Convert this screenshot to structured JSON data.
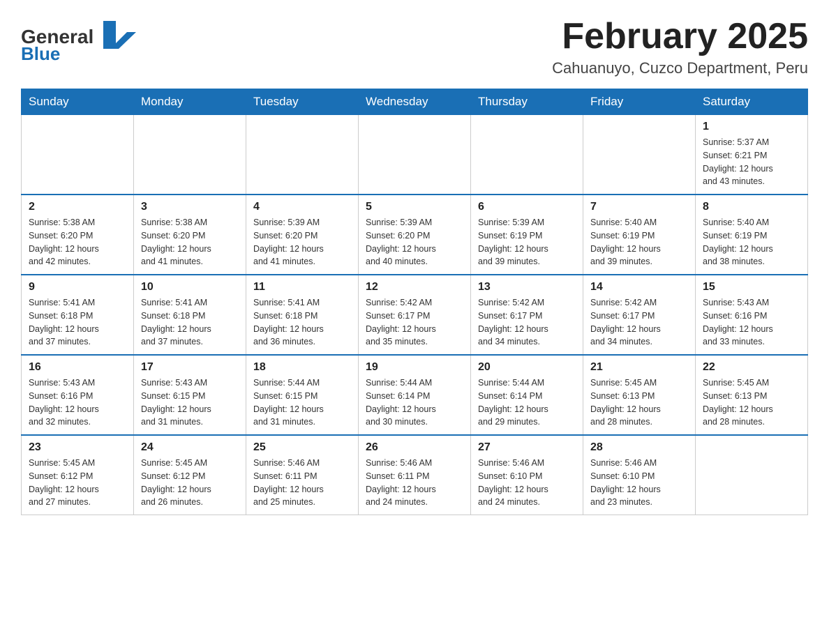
{
  "header": {
    "logo_general": "General",
    "logo_blue": "Blue",
    "month_title": "February 2025",
    "location": "Cahuanuyo, Cuzco Department, Peru"
  },
  "weekdays": [
    "Sunday",
    "Monday",
    "Tuesday",
    "Wednesday",
    "Thursday",
    "Friday",
    "Saturday"
  ],
  "weeks": [
    [
      {
        "day": "",
        "info": ""
      },
      {
        "day": "",
        "info": ""
      },
      {
        "day": "",
        "info": ""
      },
      {
        "day": "",
        "info": ""
      },
      {
        "day": "",
        "info": ""
      },
      {
        "day": "",
        "info": ""
      },
      {
        "day": "1",
        "info": "Sunrise: 5:37 AM\nSunset: 6:21 PM\nDaylight: 12 hours\nand 43 minutes."
      }
    ],
    [
      {
        "day": "2",
        "info": "Sunrise: 5:38 AM\nSunset: 6:20 PM\nDaylight: 12 hours\nand 42 minutes."
      },
      {
        "day": "3",
        "info": "Sunrise: 5:38 AM\nSunset: 6:20 PM\nDaylight: 12 hours\nand 41 minutes."
      },
      {
        "day": "4",
        "info": "Sunrise: 5:39 AM\nSunset: 6:20 PM\nDaylight: 12 hours\nand 41 minutes."
      },
      {
        "day": "5",
        "info": "Sunrise: 5:39 AM\nSunset: 6:20 PM\nDaylight: 12 hours\nand 40 minutes."
      },
      {
        "day": "6",
        "info": "Sunrise: 5:39 AM\nSunset: 6:19 PM\nDaylight: 12 hours\nand 39 minutes."
      },
      {
        "day": "7",
        "info": "Sunrise: 5:40 AM\nSunset: 6:19 PM\nDaylight: 12 hours\nand 39 minutes."
      },
      {
        "day": "8",
        "info": "Sunrise: 5:40 AM\nSunset: 6:19 PM\nDaylight: 12 hours\nand 38 minutes."
      }
    ],
    [
      {
        "day": "9",
        "info": "Sunrise: 5:41 AM\nSunset: 6:18 PM\nDaylight: 12 hours\nand 37 minutes."
      },
      {
        "day": "10",
        "info": "Sunrise: 5:41 AM\nSunset: 6:18 PM\nDaylight: 12 hours\nand 37 minutes."
      },
      {
        "day": "11",
        "info": "Sunrise: 5:41 AM\nSunset: 6:18 PM\nDaylight: 12 hours\nand 36 minutes."
      },
      {
        "day": "12",
        "info": "Sunrise: 5:42 AM\nSunset: 6:17 PM\nDaylight: 12 hours\nand 35 minutes."
      },
      {
        "day": "13",
        "info": "Sunrise: 5:42 AM\nSunset: 6:17 PM\nDaylight: 12 hours\nand 34 minutes."
      },
      {
        "day": "14",
        "info": "Sunrise: 5:42 AM\nSunset: 6:17 PM\nDaylight: 12 hours\nand 34 minutes."
      },
      {
        "day": "15",
        "info": "Sunrise: 5:43 AM\nSunset: 6:16 PM\nDaylight: 12 hours\nand 33 minutes."
      }
    ],
    [
      {
        "day": "16",
        "info": "Sunrise: 5:43 AM\nSunset: 6:16 PM\nDaylight: 12 hours\nand 32 minutes."
      },
      {
        "day": "17",
        "info": "Sunrise: 5:43 AM\nSunset: 6:15 PM\nDaylight: 12 hours\nand 31 minutes."
      },
      {
        "day": "18",
        "info": "Sunrise: 5:44 AM\nSunset: 6:15 PM\nDaylight: 12 hours\nand 31 minutes."
      },
      {
        "day": "19",
        "info": "Sunrise: 5:44 AM\nSunset: 6:14 PM\nDaylight: 12 hours\nand 30 minutes."
      },
      {
        "day": "20",
        "info": "Sunrise: 5:44 AM\nSunset: 6:14 PM\nDaylight: 12 hours\nand 29 minutes."
      },
      {
        "day": "21",
        "info": "Sunrise: 5:45 AM\nSunset: 6:13 PM\nDaylight: 12 hours\nand 28 minutes."
      },
      {
        "day": "22",
        "info": "Sunrise: 5:45 AM\nSunset: 6:13 PM\nDaylight: 12 hours\nand 28 minutes."
      }
    ],
    [
      {
        "day": "23",
        "info": "Sunrise: 5:45 AM\nSunset: 6:12 PM\nDaylight: 12 hours\nand 27 minutes."
      },
      {
        "day": "24",
        "info": "Sunrise: 5:45 AM\nSunset: 6:12 PM\nDaylight: 12 hours\nand 26 minutes."
      },
      {
        "day": "25",
        "info": "Sunrise: 5:46 AM\nSunset: 6:11 PM\nDaylight: 12 hours\nand 25 minutes."
      },
      {
        "day": "26",
        "info": "Sunrise: 5:46 AM\nSunset: 6:11 PM\nDaylight: 12 hours\nand 24 minutes."
      },
      {
        "day": "27",
        "info": "Sunrise: 5:46 AM\nSunset: 6:10 PM\nDaylight: 12 hours\nand 24 minutes."
      },
      {
        "day": "28",
        "info": "Sunrise: 5:46 AM\nSunset: 6:10 PM\nDaylight: 12 hours\nand 23 minutes."
      },
      {
        "day": "",
        "info": ""
      }
    ]
  ]
}
